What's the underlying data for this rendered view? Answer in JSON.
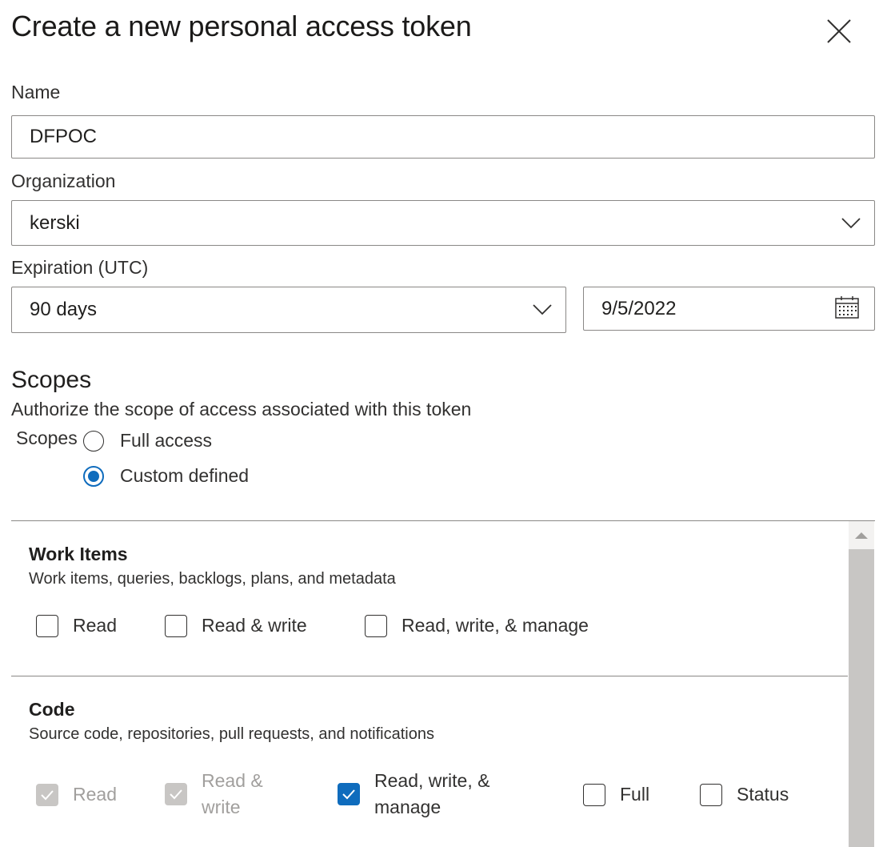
{
  "dialog": {
    "title": "Create a new personal access token"
  },
  "form": {
    "name": {
      "label": "Name",
      "value": "DFPOC"
    },
    "organization": {
      "label": "Organization",
      "value": "kerski"
    },
    "expiration": {
      "label": "Expiration (UTC)",
      "value": "90 days",
      "date": "9/5/2022"
    }
  },
  "scopes": {
    "title": "Scopes",
    "description": "Authorize the scope of access associated with this token",
    "group_label": "Scopes",
    "options": [
      {
        "label": "Full access",
        "selected": false
      },
      {
        "label": "Custom defined",
        "selected": true
      }
    ]
  },
  "scope_sections": [
    {
      "title": "Work Items",
      "description": "Work items, queries, backlogs, plans, and metadata",
      "permissions": [
        {
          "label": "Read",
          "checked": false,
          "disabled": false
        },
        {
          "label": "Read & write",
          "checked": false,
          "disabled": false
        },
        {
          "label": "Read, write, & manage",
          "checked": false,
          "disabled": false
        }
      ]
    },
    {
      "title": "Code",
      "description": "Source code, repositories, pull requests, and notifications",
      "permissions": [
        {
          "label": "Read",
          "checked": true,
          "disabled": true
        },
        {
          "label_line1": "Read &",
          "label_line2": "write",
          "checked": true,
          "disabled": true
        },
        {
          "label_line1": "Read, write, &",
          "label_line2": "manage",
          "checked": true,
          "disabled": false
        },
        {
          "label": "Full",
          "checked": false,
          "disabled": false
        },
        {
          "label": "Status",
          "checked": false,
          "disabled": false
        }
      ]
    }
  ],
  "colors": {
    "accent": "#0f6cbd",
    "border": "#8a8886",
    "disabled": "#c8c6c4",
    "text": "#201f1e"
  }
}
